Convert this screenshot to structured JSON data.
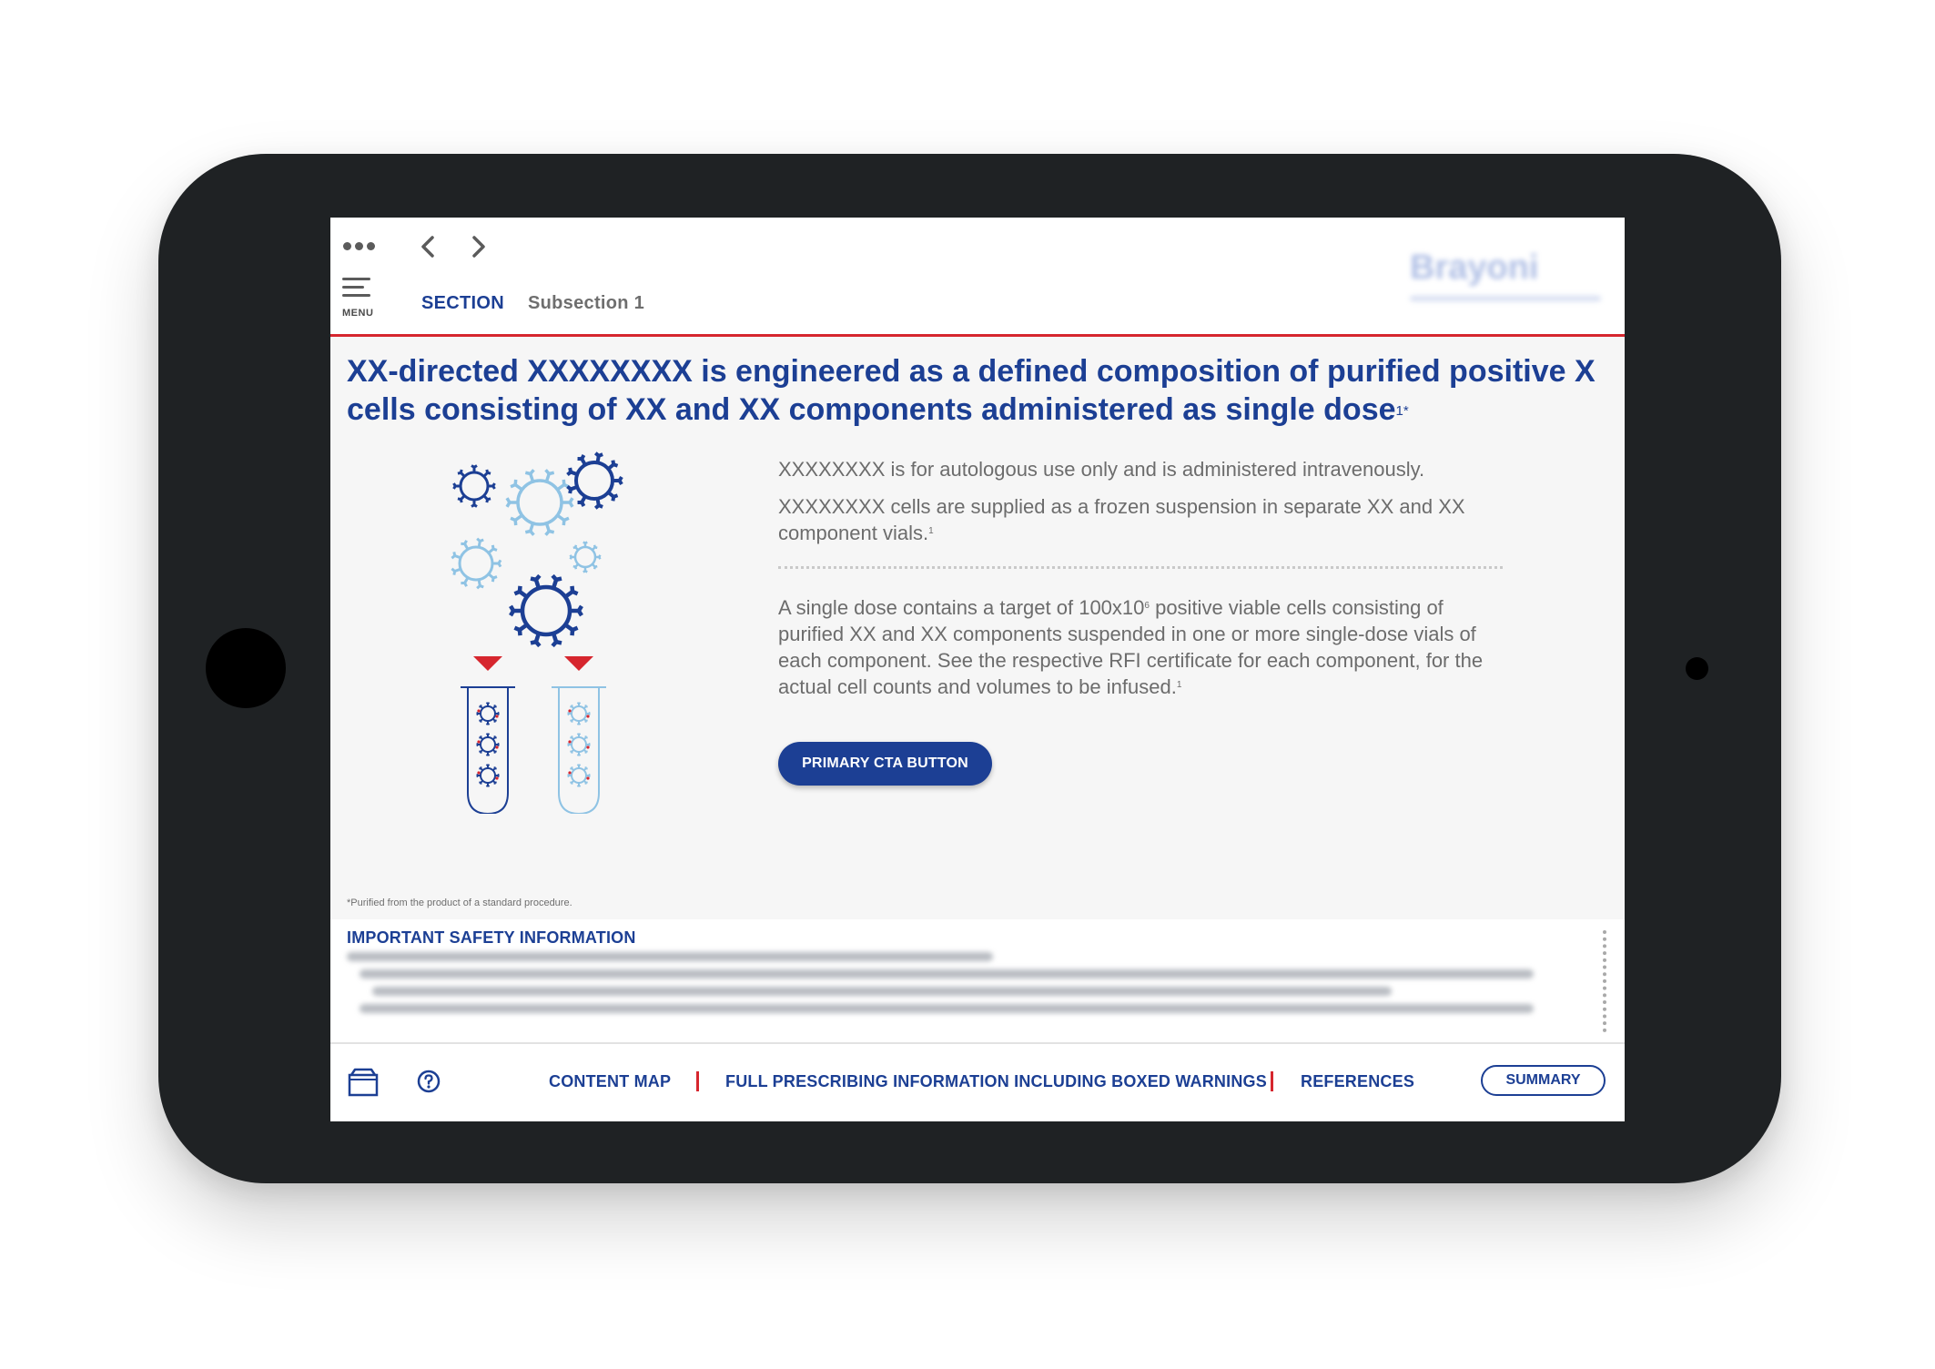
{
  "header": {
    "menu_label": "MENU",
    "tabs": [
      {
        "label": "SECTION",
        "active": true
      },
      {
        "label": "Subsection 1",
        "active": false
      }
    ],
    "logo_text": "Brayoni"
  },
  "content": {
    "headline": "XX-directed XXXXXXXX is engineered as a defined composition of purified positive X cells consisting of XX and XX components administered as single dose",
    "headline_sup": "1*",
    "para1": "XXXXXXXX is for autologous use only and is administered intravenously.",
    "para2": "XXXXXXXX cells are supplied as a frozen suspension in separate XX and XX component vials.",
    "para2_sup": "1",
    "para3_a": "A single dose contains a target of 100x10",
    "para3_exp": "6",
    "para3_b": " positive viable cells consisting of purified XX and XX components suspended in one or more single-dose vials of each component. See the respective RFI certificate for each component, for the actual cell counts and volumes to be infused.",
    "para3_sup": "1",
    "cta_label": "PRIMARY CTA BUTTON",
    "footnote": "*Purified from the product of a standard procedure."
  },
  "isi": {
    "title": "IMPORTANT SAFETY INFORMATION"
  },
  "footer": {
    "links": [
      "CONTENT MAP",
      "FULL PRESCRIBING INFORMATION INCLUDING BOXED WARNINGS",
      "REFERENCES"
    ],
    "summary_label": "SUMMARY"
  },
  "colors": {
    "brand_blue": "#1c3f94",
    "accent_red": "#d6262e",
    "light_blue": "#8fc3e4",
    "device_frame": "#1f2224"
  },
  "icons": [
    "more-dots-icon",
    "chevron-left-icon",
    "chevron-right-icon",
    "menu-icon",
    "box-icon",
    "help-icon"
  ]
}
